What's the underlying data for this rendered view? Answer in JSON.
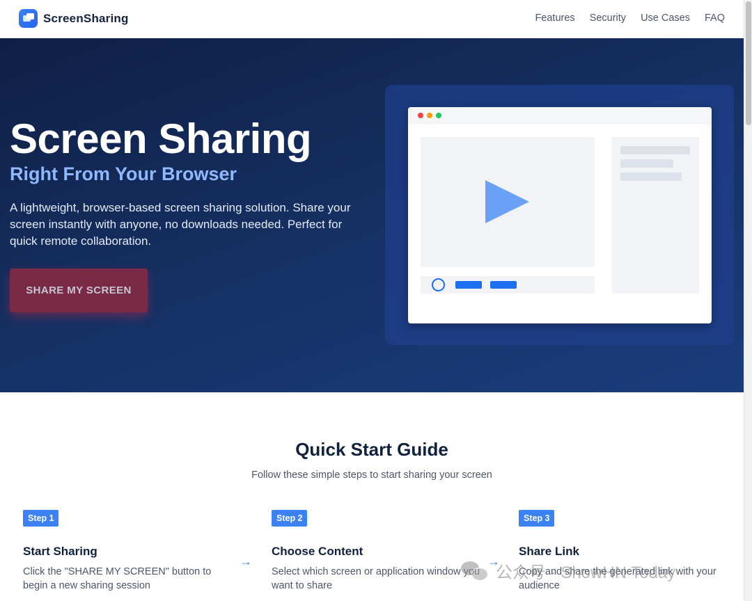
{
  "header": {
    "logo_text": "ScreenSharing",
    "nav": [
      "Features",
      "Security",
      "Use Cases",
      "FAQ"
    ]
  },
  "hero": {
    "title": "Screen Sharing",
    "subtitle": "Right From Your Browser",
    "description": "A lightweight, browser-based screen sharing solution. Share your screen instantly with anyone, no downloads needed. Perfect for quick remote collaboration.",
    "cta_label": "SHARE MY SCREEN"
  },
  "quick_start": {
    "title": "Quick Start Guide",
    "subtitle": "Follow these simple steps to start sharing your screen",
    "steps": [
      {
        "badge": "Step 1",
        "title": "Start Sharing",
        "description": "Click the \"SHARE MY SCREEN\" button to begin a new sharing session"
      },
      {
        "badge": "Step 2",
        "title": "Choose Content",
        "description": "Select which screen or application window you want to share"
      },
      {
        "badge": "Step 3",
        "title": "Share Link",
        "description": "Copy and share the generated link with your audience"
      }
    ]
  },
  "watermark": {
    "text": "公众号 · ShowHN Today"
  },
  "colors": {
    "accent": "#3b82f6",
    "hero_bg": "#163063",
    "cta_bg": "#7a2a45",
    "subtitle": "#8fb8ff"
  }
}
